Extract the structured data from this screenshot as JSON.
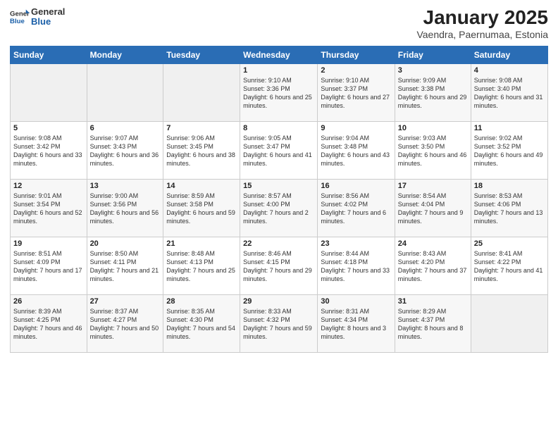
{
  "logo": {
    "general": "General",
    "blue": "Blue"
  },
  "header": {
    "month": "January 2025",
    "location": "Vaendra, Paernumaa, Estonia"
  },
  "weekdays": [
    "Sunday",
    "Monday",
    "Tuesday",
    "Wednesday",
    "Thursday",
    "Friday",
    "Saturday"
  ],
  "weeks": [
    [
      {
        "day": "",
        "content": ""
      },
      {
        "day": "",
        "content": ""
      },
      {
        "day": "",
        "content": ""
      },
      {
        "day": "1",
        "content": "Sunrise: 9:10 AM\nSunset: 3:36 PM\nDaylight: 6 hours\nand 25 minutes."
      },
      {
        "day": "2",
        "content": "Sunrise: 9:10 AM\nSunset: 3:37 PM\nDaylight: 6 hours\nand 27 minutes."
      },
      {
        "day": "3",
        "content": "Sunrise: 9:09 AM\nSunset: 3:38 PM\nDaylight: 6 hours\nand 29 minutes."
      },
      {
        "day": "4",
        "content": "Sunrise: 9:08 AM\nSunset: 3:40 PM\nDaylight: 6 hours\nand 31 minutes."
      }
    ],
    [
      {
        "day": "5",
        "content": "Sunrise: 9:08 AM\nSunset: 3:42 PM\nDaylight: 6 hours\nand 33 minutes."
      },
      {
        "day": "6",
        "content": "Sunrise: 9:07 AM\nSunset: 3:43 PM\nDaylight: 6 hours\nand 36 minutes."
      },
      {
        "day": "7",
        "content": "Sunrise: 9:06 AM\nSunset: 3:45 PM\nDaylight: 6 hours\nand 38 minutes."
      },
      {
        "day": "8",
        "content": "Sunrise: 9:05 AM\nSunset: 3:47 PM\nDaylight: 6 hours\nand 41 minutes."
      },
      {
        "day": "9",
        "content": "Sunrise: 9:04 AM\nSunset: 3:48 PM\nDaylight: 6 hours\nand 43 minutes."
      },
      {
        "day": "10",
        "content": "Sunrise: 9:03 AM\nSunset: 3:50 PM\nDaylight: 6 hours\nand 46 minutes."
      },
      {
        "day": "11",
        "content": "Sunrise: 9:02 AM\nSunset: 3:52 PM\nDaylight: 6 hours\nand 49 minutes."
      }
    ],
    [
      {
        "day": "12",
        "content": "Sunrise: 9:01 AM\nSunset: 3:54 PM\nDaylight: 6 hours\nand 52 minutes."
      },
      {
        "day": "13",
        "content": "Sunrise: 9:00 AM\nSunset: 3:56 PM\nDaylight: 6 hours\nand 56 minutes."
      },
      {
        "day": "14",
        "content": "Sunrise: 8:59 AM\nSunset: 3:58 PM\nDaylight: 6 hours\nand 59 minutes."
      },
      {
        "day": "15",
        "content": "Sunrise: 8:57 AM\nSunset: 4:00 PM\nDaylight: 7 hours\nand 2 minutes."
      },
      {
        "day": "16",
        "content": "Sunrise: 8:56 AM\nSunset: 4:02 PM\nDaylight: 7 hours\nand 6 minutes."
      },
      {
        "day": "17",
        "content": "Sunrise: 8:54 AM\nSunset: 4:04 PM\nDaylight: 7 hours\nand 9 minutes."
      },
      {
        "day": "18",
        "content": "Sunrise: 8:53 AM\nSunset: 4:06 PM\nDaylight: 7 hours\nand 13 minutes."
      }
    ],
    [
      {
        "day": "19",
        "content": "Sunrise: 8:51 AM\nSunset: 4:09 PM\nDaylight: 7 hours\nand 17 minutes."
      },
      {
        "day": "20",
        "content": "Sunrise: 8:50 AM\nSunset: 4:11 PM\nDaylight: 7 hours\nand 21 minutes."
      },
      {
        "day": "21",
        "content": "Sunrise: 8:48 AM\nSunset: 4:13 PM\nDaylight: 7 hours\nand 25 minutes."
      },
      {
        "day": "22",
        "content": "Sunrise: 8:46 AM\nSunset: 4:15 PM\nDaylight: 7 hours\nand 29 minutes."
      },
      {
        "day": "23",
        "content": "Sunrise: 8:44 AM\nSunset: 4:18 PM\nDaylight: 7 hours\nand 33 minutes."
      },
      {
        "day": "24",
        "content": "Sunrise: 8:43 AM\nSunset: 4:20 PM\nDaylight: 7 hours\nand 37 minutes."
      },
      {
        "day": "25",
        "content": "Sunrise: 8:41 AM\nSunset: 4:22 PM\nDaylight: 7 hours\nand 41 minutes."
      }
    ],
    [
      {
        "day": "26",
        "content": "Sunrise: 8:39 AM\nSunset: 4:25 PM\nDaylight: 7 hours\nand 46 minutes."
      },
      {
        "day": "27",
        "content": "Sunrise: 8:37 AM\nSunset: 4:27 PM\nDaylight: 7 hours\nand 50 minutes."
      },
      {
        "day": "28",
        "content": "Sunrise: 8:35 AM\nSunset: 4:30 PM\nDaylight: 7 hours\nand 54 minutes."
      },
      {
        "day": "29",
        "content": "Sunrise: 8:33 AM\nSunset: 4:32 PM\nDaylight: 7 hours\nand 59 minutes."
      },
      {
        "day": "30",
        "content": "Sunrise: 8:31 AM\nSunset: 4:34 PM\nDaylight: 8 hours\nand 3 minutes."
      },
      {
        "day": "31",
        "content": "Sunrise: 8:29 AM\nSunset: 4:37 PM\nDaylight: 8 hours\nand 8 minutes."
      },
      {
        "day": "",
        "content": ""
      }
    ]
  ]
}
